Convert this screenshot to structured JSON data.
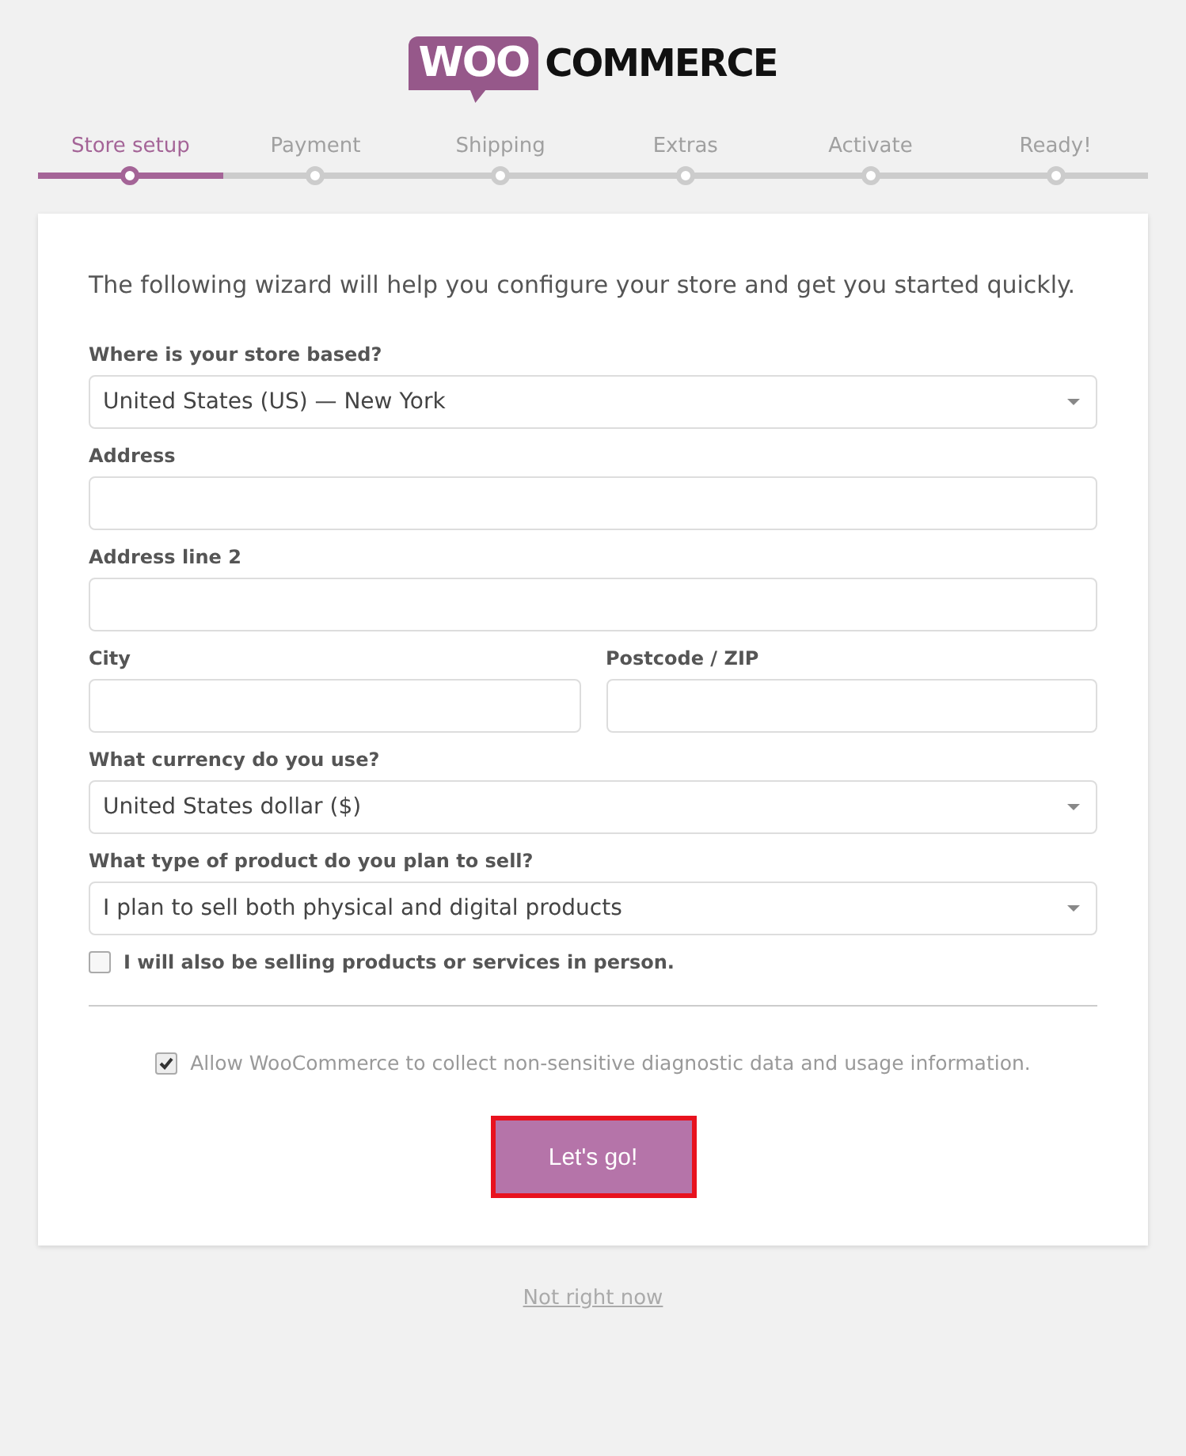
{
  "logo": {
    "badge": "WOO",
    "word": "COMMERCE"
  },
  "steps": [
    {
      "label": "Store setup",
      "selected": true
    },
    {
      "label": "Payment",
      "selected": false
    },
    {
      "label": "Shipping",
      "selected": false
    },
    {
      "label": "Extras",
      "selected": false
    },
    {
      "label": "Activate",
      "selected": false
    },
    {
      "label": "Ready!",
      "selected": false
    }
  ],
  "intro": "The following wizard will help you configure your store and get you started quickly.",
  "rows": [
    [
      {
        "kind": "select",
        "label": "Where is your store based?",
        "value": "United States (US) — New York"
      }
    ],
    [
      {
        "kind": "text",
        "label": "Address"
      }
    ],
    [
      {
        "kind": "text",
        "label": "Address line 2"
      }
    ],
    [
      {
        "kind": "text",
        "label": "City"
      },
      {
        "kind": "text",
        "label": "Postcode / ZIP"
      }
    ],
    [
      {
        "kind": "select",
        "label": "What currency do you use?",
        "value": "United States dollar ($)"
      }
    ],
    [
      {
        "kind": "select",
        "label": "What type of product do you plan to sell?",
        "value": "I plan to sell both physical and digital products"
      }
    ]
  ],
  "in_person": {
    "label": "I will also be selling products or services in person.",
    "checked": false
  },
  "tracking": {
    "label": "Allow WooCommerce to collect non-sensitive diagnostic data and usage information.",
    "checked": true
  },
  "submit": {
    "label": "Let's go!",
    "highlighted": true
  },
  "skip_link": "Not right now"
}
